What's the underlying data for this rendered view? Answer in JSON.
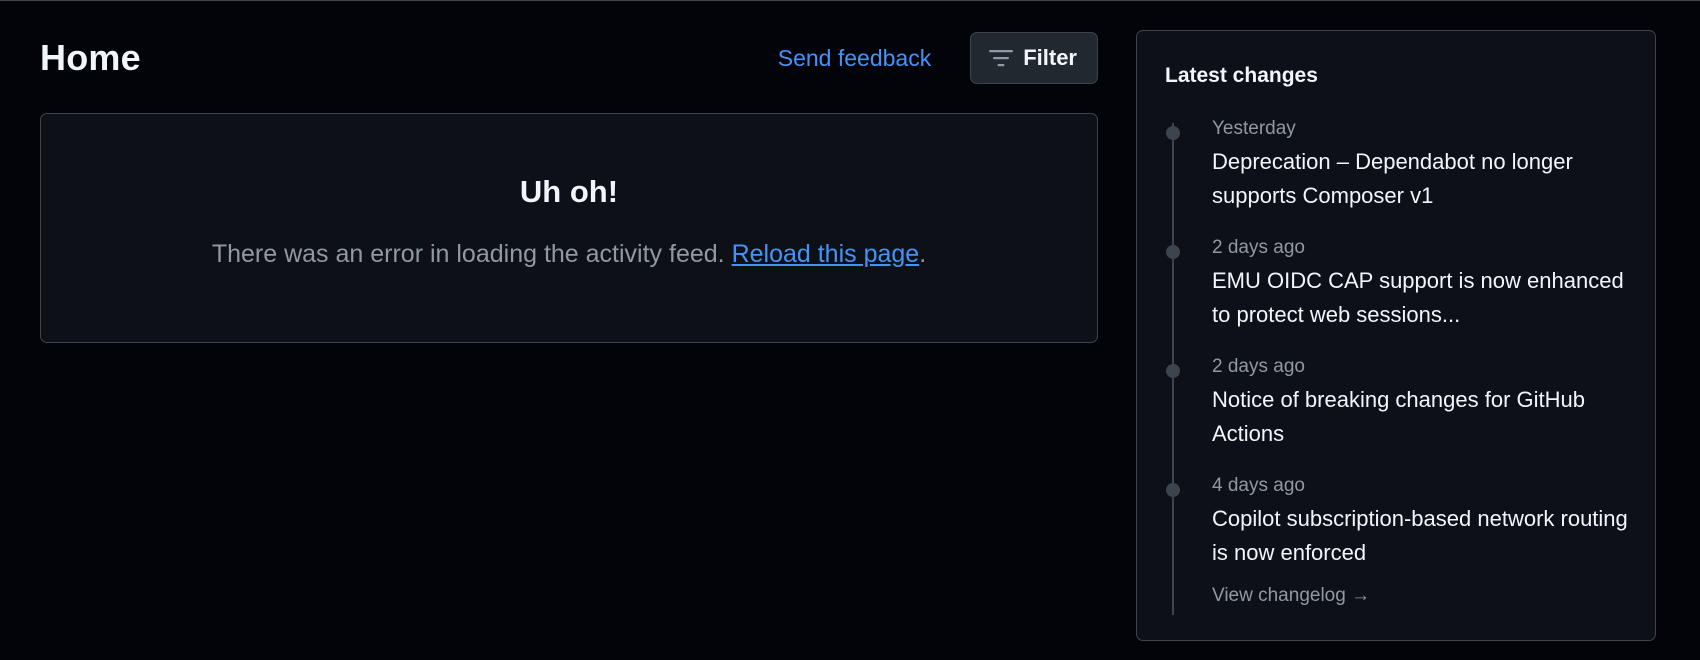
{
  "header": {
    "title": "Home",
    "feedback_label": "Send feedback",
    "filter_label": "Filter",
    "filter_icon": "filter-icon"
  },
  "error": {
    "heading": "Uh oh!",
    "message": "There was an error in loading the activity feed.",
    "link_label": "Reload this page",
    "suffix": "."
  },
  "sidebar": {
    "title": "Latest changes",
    "items": [
      {
        "date": "Yesterday",
        "title": "Deprecation – Dependabot no longer supports Composer v1"
      },
      {
        "date": "2 days ago",
        "title": "EMU OIDC CAP support is now enhanced to protect web sessions..."
      },
      {
        "date": "2 days ago",
        "title": "Notice of breaking changes for GitHub Actions"
      },
      {
        "date": "4 days ago",
        "title": "Copilot subscription-based network routing is now enforced"
      }
    ],
    "view_changelog_label": "View changelog →"
  },
  "colors": {
    "background": "#02040a",
    "panel": "#0d1117",
    "border": "#3d444d",
    "link": "#4493f8",
    "muted_text": "#9198a1",
    "text": "#f0f6fc"
  }
}
